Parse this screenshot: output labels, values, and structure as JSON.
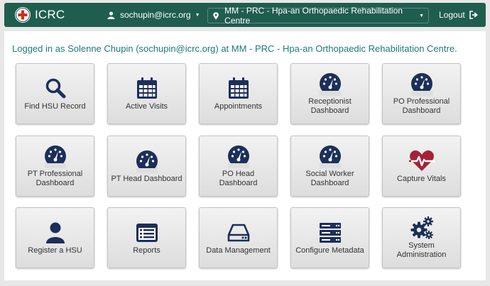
{
  "navbar": {
    "brand": "ICRC",
    "user": "sochupin@icrc.org",
    "location": "MM - PRC - Hpa-an Orthopaedic Rehabilitation Centre",
    "logout": "Logout"
  },
  "login_message": "Logged in as Solenne Chupin (sochupin@icrc.org) at MM - PRC - Hpa-an Orthopaedic Rehabilitation Centre.",
  "colors": {
    "navbar": "#1f5d4f",
    "accent_text": "#1e7b74",
    "icon": "#1c2f5a",
    "heart": "#a3223a"
  },
  "tiles": [
    {
      "label": "Find HSU Record",
      "icon": "search-icon"
    },
    {
      "label": "Active Visits",
      "icon": "calendar-icon"
    },
    {
      "label": "Appointments",
      "icon": "calendar-icon"
    },
    {
      "label": "Receptionist Dashboard",
      "icon": "dashboard-icon"
    },
    {
      "label": "PO Professional Dashboard",
      "icon": "dashboard-icon"
    },
    {
      "label": "PT Professional Dashboard",
      "icon": "dashboard-icon"
    },
    {
      "label": "PT Head Dashboard",
      "icon": "dashboard-icon"
    },
    {
      "label": "PO Head Dashboard",
      "icon": "dashboard-icon"
    },
    {
      "label": "Social Worker Dashboard",
      "icon": "dashboard-icon"
    },
    {
      "label": "Capture Vitals",
      "icon": "heartbeat-icon"
    },
    {
      "label": "Register a HSU",
      "icon": "user-icon"
    },
    {
      "label": "Reports",
      "icon": "list-alt-icon"
    },
    {
      "label": "Data Management",
      "icon": "hdd-icon"
    },
    {
      "label": "Configure Metadata",
      "icon": "server-icon"
    },
    {
      "label": "System Administration",
      "icon": "cogs-icon"
    }
  ]
}
